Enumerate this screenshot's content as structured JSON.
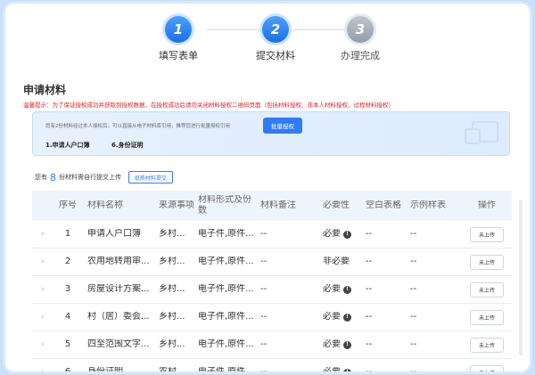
{
  "steps": [
    {
      "number": "1",
      "label": "填写表单",
      "state": "done"
    },
    {
      "number": "2",
      "label": "提交材料",
      "state": "active"
    },
    {
      "number": "3",
      "label": "办理完成",
      "state": "pending"
    }
  ],
  "section_title": "申请材料",
  "warning_text": "温馨提示：为了保证授权成功并获取到授权数据，在授权成功后请勿关闭材料授权二维码页面（包括材料授权、非本人材料授权、过程材料授权）",
  "infobox": {
    "tip": "您有2份材料经过本人授权后，可以直接从电子材料库引用，推荐您进行批量授权引用",
    "batch_button": "批量授权",
    "material_a": "1.申请人户口簿",
    "material_b": "6.身份证明"
  },
  "count_line": {
    "prefix": "您有",
    "count": "8",
    "suffix": "份材料需自行提交上传",
    "paper_button": "纸质材料提交"
  },
  "table": {
    "headers": {
      "no": "序号",
      "name": "材料名称",
      "source": "来源事项",
      "form": "材料形式及份数",
      "note": "材料备注",
      "required": "必要性",
      "blank": "空白表格",
      "sample": "示例样表",
      "op": "操作"
    },
    "rows": [
      {
        "no": "1",
        "name": "申请人户口簿",
        "source": "乡村...",
        "form": "电子件,原件...",
        "note": "--",
        "required": "必要",
        "req_info": true,
        "blank": "--",
        "sample": "--",
        "op": "未上传"
      },
      {
        "no": "2",
        "name": "农用地转用审...",
        "source": "乡村...",
        "form": "电子件,原件...",
        "note": "--",
        "required": "非必要",
        "req_info": false,
        "blank": "--",
        "sample": "--",
        "op": "未上传"
      },
      {
        "no": "3",
        "name": "房屋设计方案...",
        "source": "乡村...",
        "form": "电子件,原件...",
        "note": "--",
        "required": "必要",
        "req_info": true,
        "blank": "--",
        "sample": "--",
        "op": "未上传"
      },
      {
        "no": "4",
        "name": "村（居）委会...",
        "source": "乡村...",
        "form": "电子件,原件...",
        "note": "--",
        "required": "必要",
        "req_info": true,
        "blank": "--",
        "sample": "--",
        "op": "未上传"
      },
      {
        "no": "5",
        "name": "四至范围文字...",
        "source": "乡村...",
        "form": "电子件,原件...",
        "note": "--",
        "required": "必要",
        "req_info": true,
        "blank": "--",
        "sample": "--",
        "op": "未上传"
      },
      {
        "no": "6",
        "name": "身份证明",
        "source": "农村...",
        "form": "电子件,原件...",
        "note": "--",
        "required": "必要",
        "req_info": true,
        "blank": "--",
        "sample": "--",
        "op": "未上传"
      }
    ]
  },
  "colors": {
    "accent": "#2f7cf6",
    "warning": "#e02020",
    "header_bg": "#eef4fc"
  }
}
